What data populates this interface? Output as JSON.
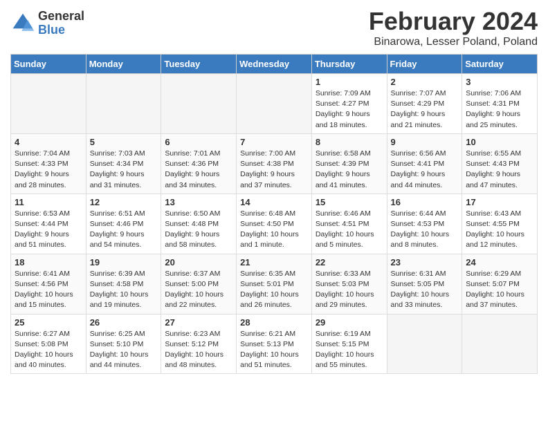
{
  "logo": {
    "general": "General",
    "blue": "Blue"
  },
  "title": "February 2024",
  "location": "Binarowa, Lesser Poland, Poland",
  "days_of_week": [
    "Sunday",
    "Monday",
    "Tuesday",
    "Wednesday",
    "Thursday",
    "Friday",
    "Saturday"
  ],
  "weeks": [
    [
      {
        "num": "",
        "info": ""
      },
      {
        "num": "",
        "info": ""
      },
      {
        "num": "",
        "info": ""
      },
      {
        "num": "",
        "info": ""
      },
      {
        "num": "1",
        "info": "Sunrise: 7:09 AM\nSunset: 4:27 PM\nDaylight: 9 hours\nand 18 minutes."
      },
      {
        "num": "2",
        "info": "Sunrise: 7:07 AM\nSunset: 4:29 PM\nDaylight: 9 hours\nand 21 minutes."
      },
      {
        "num": "3",
        "info": "Sunrise: 7:06 AM\nSunset: 4:31 PM\nDaylight: 9 hours\nand 25 minutes."
      }
    ],
    [
      {
        "num": "4",
        "info": "Sunrise: 7:04 AM\nSunset: 4:33 PM\nDaylight: 9 hours\nand 28 minutes."
      },
      {
        "num": "5",
        "info": "Sunrise: 7:03 AM\nSunset: 4:34 PM\nDaylight: 9 hours\nand 31 minutes."
      },
      {
        "num": "6",
        "info": "Sunrise: 7:01 AM\nSunset: 4:36 PM\nDaylight: 9 hours\nand 34 minutes."
      },
      {
        "num": "7",
        "info": "Sunrise: 7:00 AM\nSunset: 4:38 PM\nDaylight: 9 hours\nand 37 minutes."
      },
      {
        "num": "8",
        "info": "Sunrise: 6:58 AM\nSunset: 4:39 PM\nDaylight: 9 hours\nand 41 minutes."
      },
      {
        "num": "9",
        "info": "Sunrise: 6:56 AM\nSunset: 4:41 PM\nDaylight: 9 hours\nand 44 minutes."
      },
      {
        "num": "10",
        "info": "Sunrise: 6:55 AM\nSunset: 4:43 PM\nDaylight: 9 hours\nand 47 minutes."
      }
    ],
    [
      {
        "num": "11",
        "info": "Sunrise: 6:53 AM\nSunset: 4:44 PM\nDaylight: 9 hours\nand 51 minutes."
      },
      {
        "num": "12",
        "info": "Sunrise: 6:51 AM\nSunset: 4:46 PM\nDaylight: 9 hours\nand 54 minutes."
      },
      {
        "num": "13",
        "info": "Sunrise: 6:50 AM\nSunset: 4:48 PM\nDaylight: 9 hours\nand 58 minutes."
      },
      {
        "num": "14",
        "info": "Sunrise: 6:48 AM\nSunset: 4:50 PM\nDaylight: 10 hours\nand 1 minute."
      },
      {
        "num": "15",
        "info": "Sunrise: 6:46 AM\nSunset: 4:51 PM\nDaylight: 10 hours\nand 5 minutes."
      },
      {
        "num": "16",
        "info": "Sunrise: 6:44 AM\nSunset: 4:53 PM\nDaylight: 10 hours\nand 8 minutes."
      },
      {
        "num": "17",
        "info": "Sunrise: 6:43 AM\nSunset: 4:55 PM\nDaylight: 10 hours\nand 12 minutes."
      }
    ],
    [
      {
        "num": "18",
        "info": "Sunrise: 6:41 AM\nSunset: 4:56 PM\nDaylight: 10 hours\nand 15 minutes."
      },
      {
        "num": "19",
        "info": "Sunrise: 6:39 AM\nSunset: 4:58 PM\nDaylight: 10 hours\nand 19 minutes."
      },
      {
        "num": "20",
        "info": "Sunrise: 6:37 AM\nSunset: 5:00 PM\nDaylight: 10 hours\nand 22 minutes."
      },
      {
        "num": "21",
        "info": "Sunrise: 6:35 AM\nSunset: 5:01 PM\nDaylight: 10 hours\nand 26 minutes."
      },
      {
        "num": "22",
        "info": "Sunrise: 6:33 AM\nSunset: 5:03 PM\nDaylight: 10 hours\nand 29 minutes."
      },
      {
        "num": "23",
        "info": "Sunrise: 6:31 AM\nSunset: 5:05 PM\nDaylight: 10 hours\nand 33 minutes."
      },
      {
        "num": "24",
        "info": "Sunrise: 6:29 AM\nSunset: 5:07 PM\nDaylight: 10 hours\nand 37 minutes."
      }
    ],
    [
      {
        "num": "25",
        "info": "Sunrise: 6:27 AM\nSunset: 5:08 PM\nDaylight: 10 hours\nand 40 minutes."
      },
      {
        "num": "26",
        "info": "Sunrise: 6:25 AM\nSunset: 5:10 PM\nDaylight: 10 hours\nand 44 minutes."
      },
      {
        "num": "27",
        "info": "Sunrise: 6:23 AM\nSunset: 5:12 PM\nDaylight: 10 hours\nand 48 minutes."
      },
      {
        "num": "28",
        "info": "Sunrise: 6:21 AM\nSunset: 5:13 PM\nDaylight: 10 hours\nand 51 minutes."
      },
      {
        "num": "29",
        "info": "Sunrise: 6:19 AM\nSunset: 5:15 PM\nDaylight: 10 hours\nand 55 minutes."
      },
      {
        "num": "",
        "info": ""
      },
      {
        "num": "",
        "info": ""
      }
    ]
  ]
}
